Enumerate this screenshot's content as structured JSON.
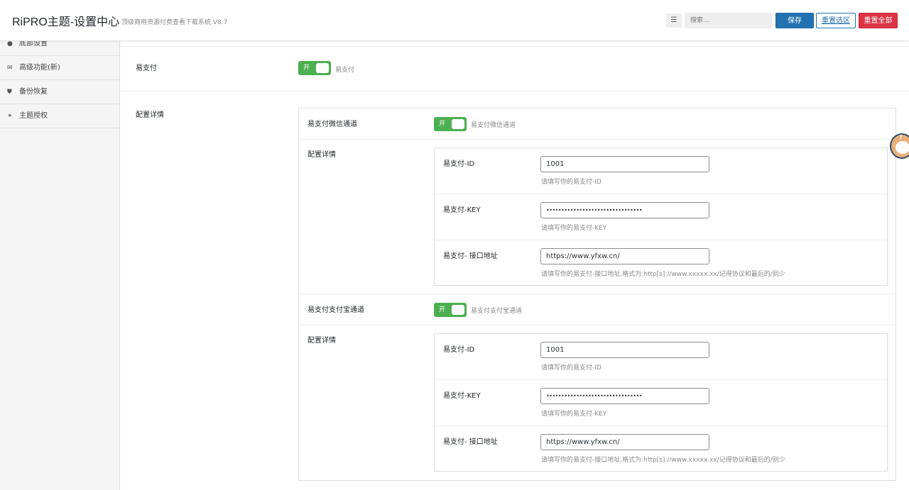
{
  "header": {
    "logo": "RiPRO主题-设置中心",
    "subtitle": "顶级商用资源付费查看下载系统 V8.7",
    "search_icon": "list-icon",
    "search_placeholder": "搜索...",
    "save_label": "保存",
    "reset_section_label": "重置选区",
    "reset_all_label": "重置全部"
  },
  "sidebar": {
    "items": [
      {
        "label": "底部设置",
        "icon": "circle-icon"
      },
      {
        "label": "高级功能(新)",
        "icon": "envelope-icon"
      },
      {
        "label": "备份恢复",
        "icon": "shield-icon"
      },
      {
        "label": "主题授权",
        "icon": "handshake-icon"
      }
    ]
  },
  "main": {
    "epay": {
      "label": "易支付",
      "switch_text": "开",
      "switch_desc": "易支付"
    },
    "config": {
      "label": "配置详情",
      "wechat": {
        "label": "易支付微信通道",
        "switch_text": "开",
        "switch_desc": "易支付微信通道",
        "config_label": "配置详情",
        "id_label": "易支付-ID",
        "id_value": "1001",
        "id_desc": "请填写你的易支付-ID",
        "key_label": "易支付-KEY",
        "key_value": "••••••••••••••••••••••••••••••••",
        "key_desc": "请填写你的易支付-KEY",
        "url_label": "易支付- 接口地址",
        "url_value": "https://www.yfxw.cn/",
        "url_desc": "请填写你的易支付-接口地址,格式为:http[s]://www.xxxxx.xx/记得协议和最后的/别少"
      },
      "alipay": {
        "label": "易支付支付宝通道",
        "switch_text": "开",
        "switch_desc": "易支付支付宝通道",
        "config_label": "配置详情",
        "id_label": "易支付-ID",
        "id_value": "1001",
        "id_desc": "请填写你的易支付-ID",
        "key_label": "易支付-KEY",
        "key_value": "••••••••••••••••••••••••••••••••",
        "key_desc": "请填写你的易支付-KEY",
        "url_label": "易支付- 接口地址",
        "url_value": "https://www.yfxw.cn/",
        "url_desc": "请填写你的易支付-接口地址,格式为:http[s]://www.xxxxx.xx/记得协议和最后的/别少"
      }
    }
  },
  "colors": {
    "primary": "#2271b1",
    "danger": "#dc3545",
    "switch_on": "#4caf50"
  }
}
